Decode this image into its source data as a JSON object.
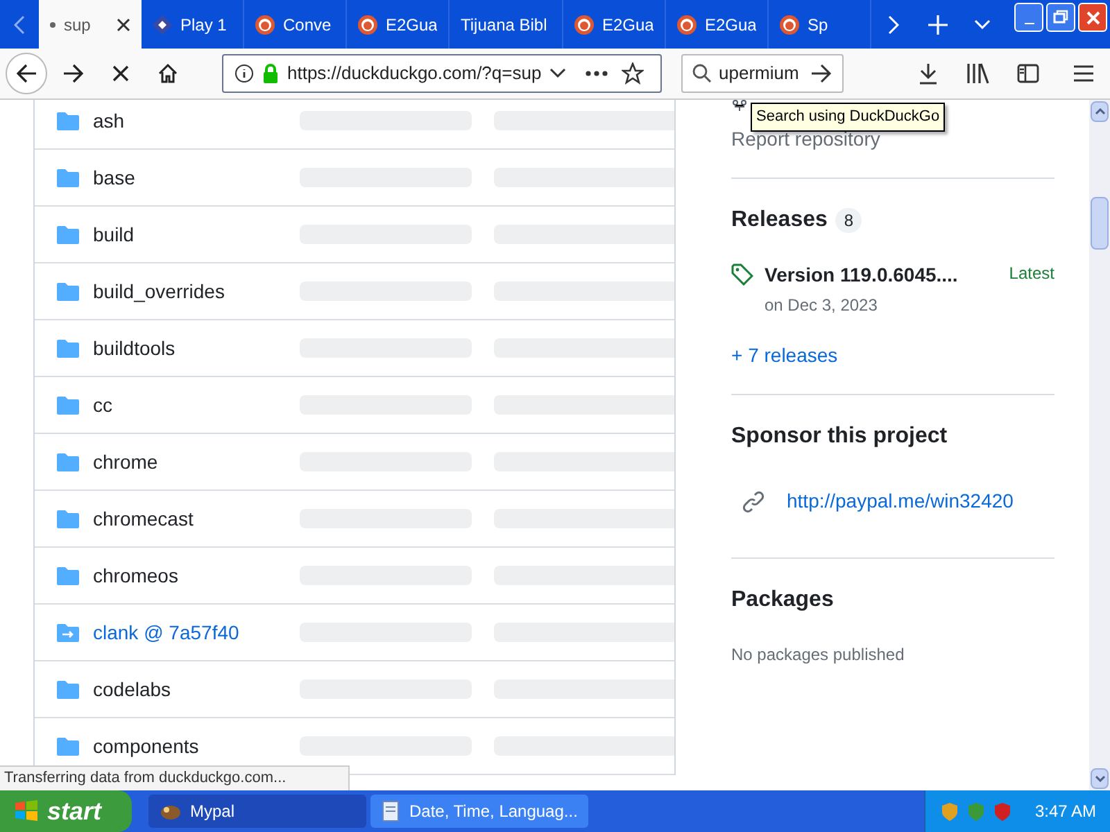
{
  "tabs": [
    {
      "label": "sup",
      "kind": "loading",
      "selected": true
    },
    {
      "label": "Play 1",
      "kind": "app",
      "selected": false
    },
    {
      "label": "Conve",
      "kind": "search",
      "selected": false
    },
    {
      "label": "E2Gua",
      "kind": "search",
      "selected": false
    },
    {
      "label": "Tijuana Bibl",
      "kind": "plain",
      "selected": false
    },
    {
      "label": "E2Gua",
      "kind": "search",
      "selected": false
    },
    {
      "label": "E2Gua",
      "kind": "search",
      "selected": false
    },
    {
      "label": "Sp",
      "kind": "search",
      "selected": false
    }
  ],
  "address_bar": {
    "url": "https://duckduckgo.com/?q=sup",
    "secure": true
  },
  "search_field": {
    "value": "upermium"
  },
  "tooltip": "Search using DuckDuckGo",
  "files": [
    {
      "name": "ash",
      "kind": "folder"
    },
    {
      "name": "base",
      "kind": "folder"
    },
    {
      "name": "build",
      "kind": "folder"
    },
    {
      "name": "build_overrides",
      "kind": "folder"
    },
    {
      "name": "buildtools",
      "kind": "folder"
    },
    {
      "name": "cc",
      "kind": "folder"
    },
    {
      "name": "chrome",
      "kind": "folder"
    },
    {
      "name": "chromecast",
      "kind": "folder"
    },
    {
      "name": "chromeos",
      "kind": "folder"
    },
    {
      "name": "clank @ 7a57f40",
      "kind": "submodule"
    },
    {
      "name": "codelabs",
      "kind": "folder"
    },
    {
      "name": "components",
      "kind": "folder"
    }
  ],
  "sidebar": {
    "report_link": "Report repository",
    "releases": {
      "title": "Releases",
      "count": "8",
      "latest": {
        "name": "Version 119.0.6045....",
        "badge": "Latest",
        "date": "on Dec 3, 2023"
      },
      "more_link": "+ 7 releases"
    },
    "sponsor": {
      "title": "Sponsor this project",
      "link": "http://paypal.me/win32420"
    },
    "packages": {
      "title": "Packages",
      "note": "No packages published"
    }
  },
  "status_text": "Transferring data from duckduckgo.com...",
  "taskbar": {
    "start": "start",
    "tasks": [
      {
        "label": "Mypal",
        "selected": true
      },
      {
        "label": "Date, Time, Languag...",
        "selected": false
      }
    ],
    "clock": "3:47 AM"
  }
}
